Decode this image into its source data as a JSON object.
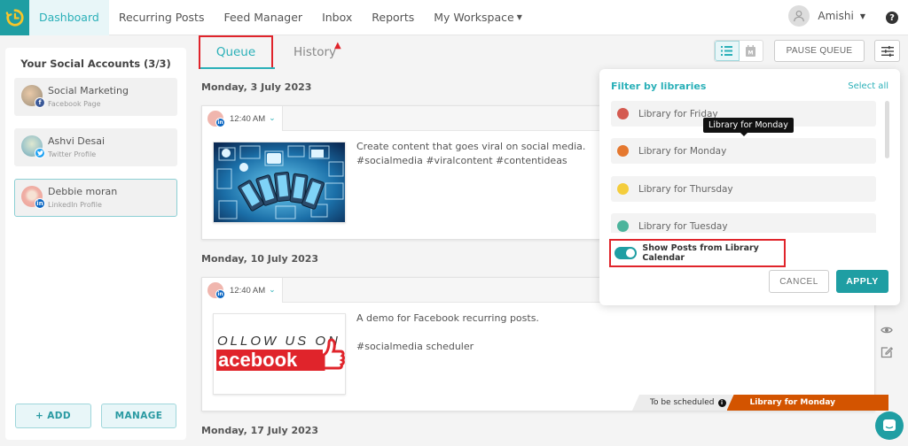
{
  "nav": {
    "items": [
      {
        "label": "Dashboard",
        "active": true
      },
      {
        "label": "Recurring Posts",
        "active": false
      },
      {
        "label": "Feed Manager",
        "active": false
      },
      {
        "label": "Inbox",
        "active": false
      },
      {
        "label": "Reports",
        "active": false
      },
      {
        "label": "My Workspace",
        "active": false,
        "dropdown": true
      }
    ],
    "user_name": "Amishi",
    "help_icon": "?",
    "logo_icon": "clock-history-icon"
  },
  "sidebar": {
    "title": "Your Social Accounts (3/3)",
    "accounts": [
      {
        "name": "Social Marketing",
        "type": "Facebook Page",
        "network": "facebook",
        "badge": "f",
        "badge_color": "#3b5998",
        "selected": false
      },
      {
        "name": "Ashvi Desai",
        "type": "Twitter Profile",
        "network": "twitter",
        "badge": "t",
        "badge_color": "#1da1f2",
        "selected": false
      },
      {
        "name": "Debbie moran",
        "type": "LinkedIn Profile",
        "network": "linkedin",
        "badge": "in",
        "badge_color": "#0a66c2",
        "selected": true
      }
    ],
    "add_label": "+ ADD",
    "manage_label": "MANAGE"
  },
  "tabs": {
    "queue": "Queue",
    "history": "History",
    "history_warning_icon": "▲"
  },
  "toolbar": {
    "pause_label": "PAUSE QUEUE",
    "calendar_badge": "M"
  },
  "feed": {
    "groups": [
      {
        "date": "Monday, 3 July 2023",
        "post": {
          "time": "12:40 AM",
          "network_badge": "in",
          "image": "social-media-phones-image",
          "text_lines": [
            "Create content that goes viral on social media.",
            "#socialmedia #viralcontent #contentideas"
          ]
        }
      },
      {
        "date": "Monday, 10 July 2023",
        "post": {
          "time": "12:40 AM",
          "network_badge": "in",
          "image": "follow-us-on-facebook-image",
          "image_text_top": "OLLOW US ON",
          "image_text_bottom": "acebook",
          "text_lines": [
            "A demo for Facebook recurring posts.",
            "",
            "#socialmedia scheduler"
          ],
          "status": "To be scheduled",
          "library_tag": "Library for Monday",
          "library_tag_color": "#d35400"
        }
      },
      {
        "date": "Monday, 17 July 2023"
      }
    ]
  },
  "filter_popup": {
    "title": "Filter by libraries",
    "select_all": "Select all",
    "libraries": [
      {
        "label": "Library for Friday",
        "color": "#d45a50"
      },
      {
        "label": "Library for Monday",
        "color": "#e5782f"
      },
      {
        "label": "Library for Thursday",
        "color": "#f4cd3c"
      },
      {
        "label": "Library for Tuesday",
        "color": "#4cb49c"
      }
    ],
    "tooltip": "Library for Monday",
    "toggle_label": "Show Posts from Library Calendar",
    "toggle_on": true,
    "cancel_label": "CANCEL",
    "apply_label": "APPLY"
  },
  "colors": {
    "accent": "#2ab0b8",
    "brand_teal": "#1f9ea3",
    "highlight_red": "#e0242b"
  }
}
